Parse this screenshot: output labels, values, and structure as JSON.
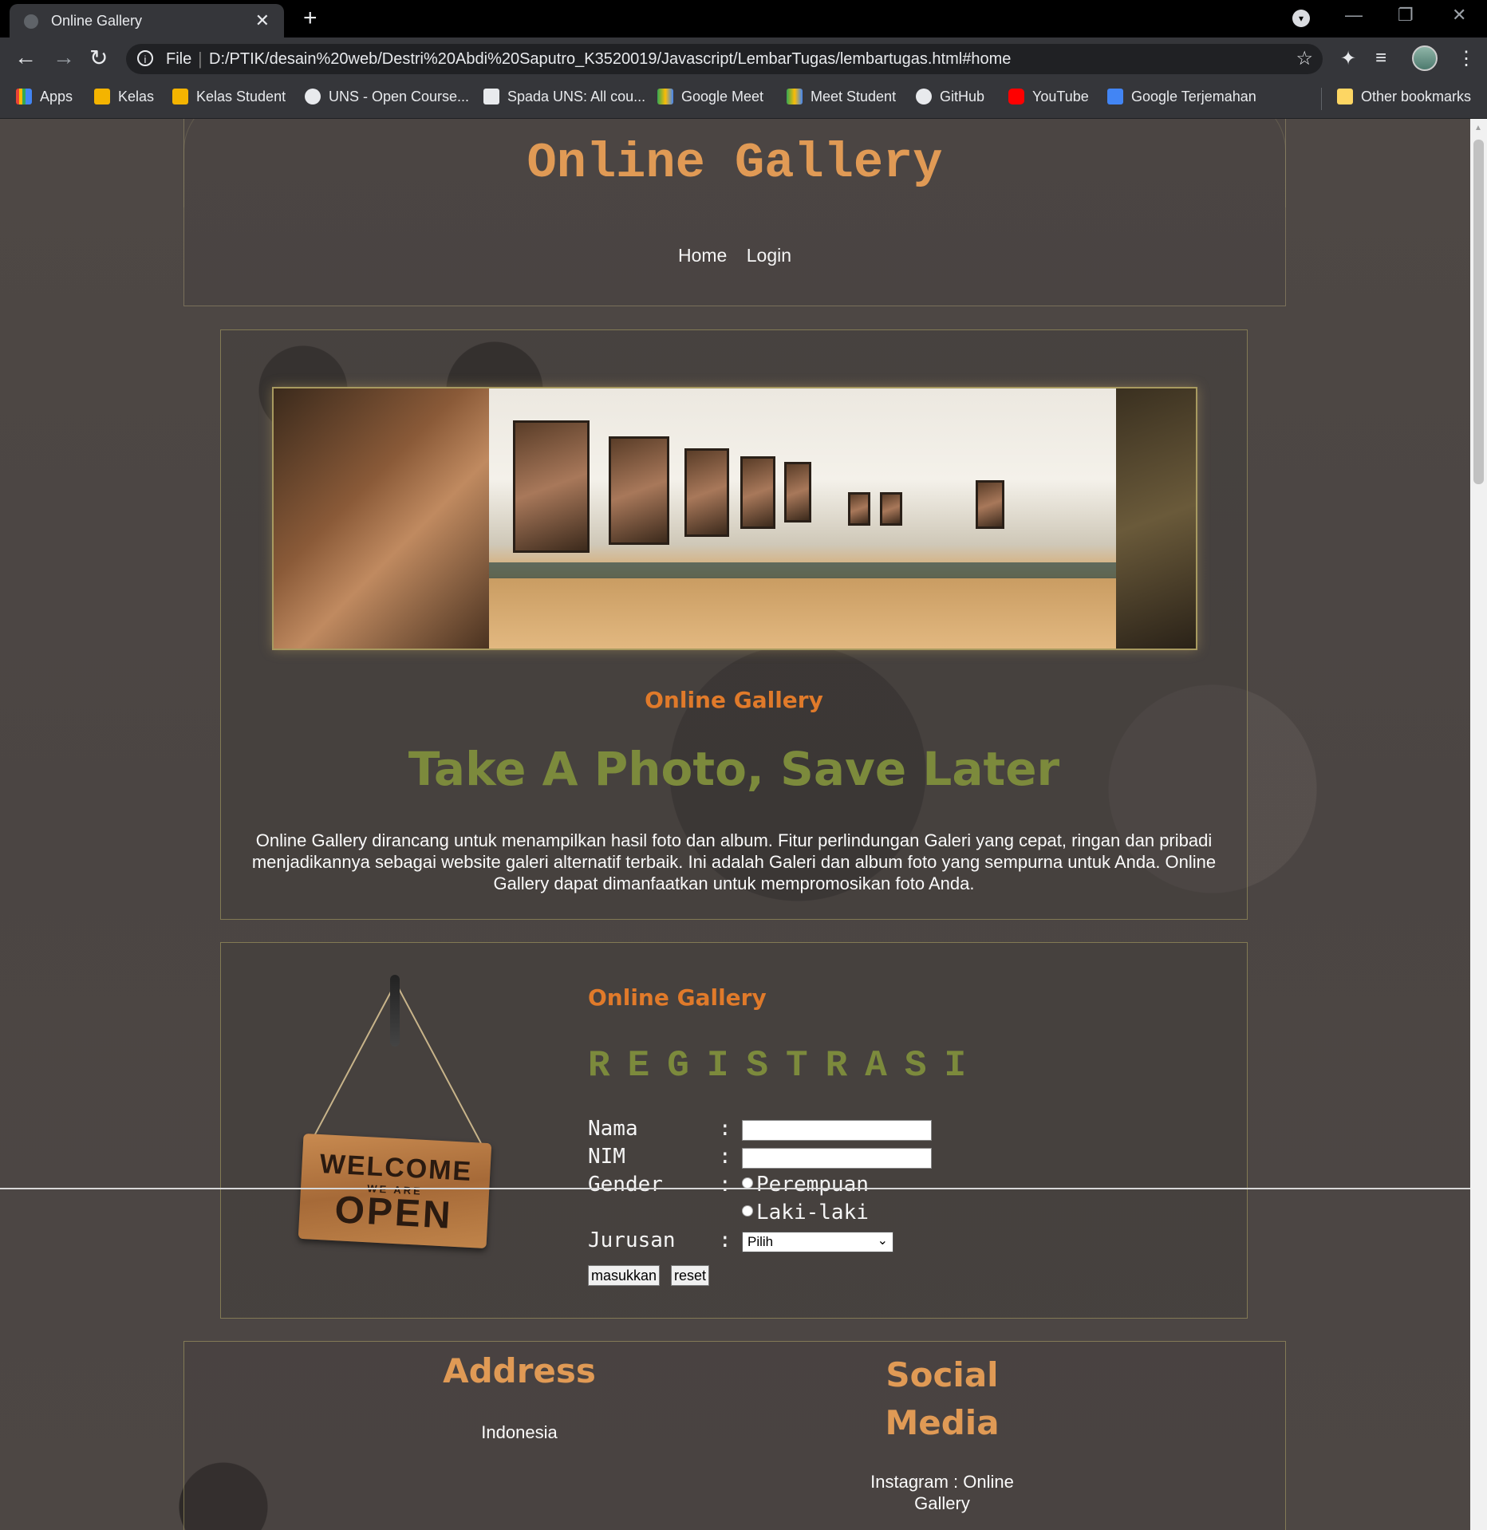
{
  "browser": {
    "tab_title": "Online Gallery",
    "omnibox_scheme": "File",
    "url": "D:/PTIK/desain%20web/Destri%20Abdi%20Saputro_K3520019/Javascript/LembarTugas/lembartugas.html#home",
    "bookmarks": [
      "Apps",
      "Kelas",
      "Kelas Student",
      "UNS - Open Course...",
      "Spada UNS: All cou...",
      "Google Meet",
      "Meet Student",
      "GitHub",
      "YouTube",
      "Google Terjemahan"
    ],
    "other_bookmarks": "Other bookmarks"
  },
  "header": {
    "title": "Online Gallery",
    "nav": [
      "Home",
      "Login"
    ]
  },
  "hero": {
    "subtitle": "Online Gallery",
    "tagline": "Take A Photo, Save Later",
    "description": "Online Gallery dirancang untuk menampilkan hasil foto dan album. Fitur perlindungan Galeri yang cepat, ringan dan pribadi menjadikannya sebagai website galeri alternatif terbaik. Ini adalah Galeri dan album foto yang sempurna untuk Anda. Online Gallery dapat dimanfaatkan untuk mempromosikan foto Anda."
  },
  "registration": {
    "sign_welcome": "WELCOME",
    "sign_we_are": "WE ARE",
    "sign_open": "OPEN",
    "subtitle": "Online Gallery",
    "title": "REGISTRASI",
    "colon": ":",
    "fields": {
      "nama": "Nama",
      "nim": "NIM",
      "gender": "Gender",
      "jurusan": "Jurusan"
    },
    "gender_options": [
      "Perempuan",
      "Laki-laki"
    ],
    "jurusan_selected": "Pilih",
    "submit_label": "masukkan",
    "reset_label": "reset"
  },
  "footer": {
    "address_title": "Address",
    "address_text": "Indonesia",
    "social_title": "Social Media",
    "social_text": "Instagram : Online Gallery"
  }
}
